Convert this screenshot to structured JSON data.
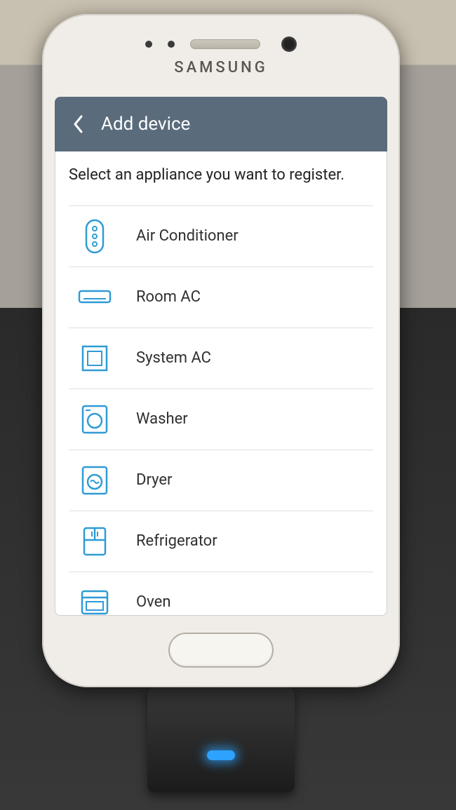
{
  "phone_brand": "SAMSUNG",
  "header": {
    "title": "Add device"
  },
  "instruction": "Select an appliance you want to register.",
  "items": [
    {
      "label": "Air Conditioner",
      "icon": "ac-remote-icon"
    },
    {
      "label": "Room AC",
      "icon": "room-ac-icon"
    },
    {
      "label": "System AC",
      "icon": "system-ac-icon"
    },
    {
      "label": "Washer",
      "icon": "washer-icon"
    },
    {
      "label": "Dryer",
      "icon": "dryer-icon"
    },
    {
      "label": "Refrigerator",
      "icon": "refrigerator-icon"
    },
    {
      "label": "Oven",
      "icon": "oven-icon"
    }
  ],
  "colors": {
    "accent": "#2f9bd6",
    "header_bg": "#5a6b7c"
  }
}
